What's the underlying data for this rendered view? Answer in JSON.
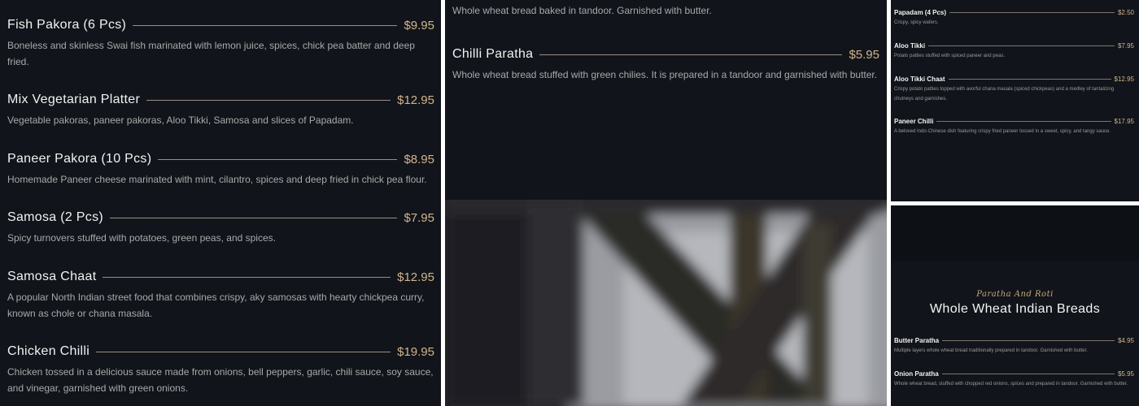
{
  "left": {
    "items": [
      {
        "name": "Fish Pakora (6 Pcs)",
        "price": "$9.95",
        "desc": "Boneless and skinless Swai fish marinated with lemon juice, spices, chick pea batter and deep fried."
      },
      {
        "name": "Mix Vegetarian Platter",
        "price": "$12.95",
        "desc": "Vegetable pakoras, paneer pakoras, Aloo Tikki, Samosa and slices of Papadam."
      },
      {
        "name": "Paneer Pakora (10 Pcs)",
        "price": "$8.95",
        "desc": "Homemade Paneer cheese marinated with mint, cilantro, spices and deep fried in chick pea flour."
      },
      {
        "name": "Samosa (2 Pcs)",
        "price": "$7.95",
        "desc": "Spicy turnovers stuffed with potatoes, green peas, and spices."
      },
      {
        "name": "Samosa Chaat",
        "price": "$12.95",
        "desc": "A popular North Indian street food that combines crispy, aky samosas with hearty chickpea curry, known as chole or chana masala."
      },
      {
        "name": "Chicken Chilli",
        "price": "$19.95",
        "desc": "Chicken tossed in a delicious sauce made from onions, bell peppers, garlic, chili sauce, soy sauce, and vinegar, garnished with green onions."
      }
    ]
  },
  "middle": {
    "top_text": "Whole wheat bread baked in tandoor. Garnished with butter.",
    "items": [
      {
        "name": "Chilli Paratha",
        "price": "$5.95",
        "desc": "Whole wheat bread stuffed with green chilies. It is prepared in a tandoor and garnished with butter."
      }
    ]
  },
  "right_top": {
    "items": [
      {
        "name": "Papadam (4 Pcs)",
        "price": "$2.50",
        "desc": "Crispy, spicy wafers."
      },
      {
        "name": "Aloo Tikki",
        "price": "$7.95",
        "desc": "Potato patties stuffed with spiced paneer and peas."
      },
      {
        "name": "Aloo Tikki Chaat",
        "price": "$12.95",
        "desc": "Crispy potato patties topped with avorful chana masala (spiced chickpeas) and a medley of tantalizing chutneys and garnishes."
      },
      {
        "name": "Paneer Chilli",
        "price": "$17.95",
        "desc": "A beloved Indo-Chinese dish featuring crispy fried paneer tossed in a sweet, spicy, and tangy sauce."
      }
    ]
  },
  "right_bottom": {
    "section_subtitle": "Paratha And Roti",
    "section_title": "Whole Wheat Indian Breads",
    "items": [
      {
        "name": "Butter Paratha",
        "price": "$4.95",
        "desc": "Multiple layers whole wheat bread traditionally prepared in tandoor. Garnished with butter."
      },
      {
        "name": "Onion Paratha",
        "price": "$5.95",
        "desc": "Whole wheat bread, stuffed with chopped red onions, spices and prepared in tandoor. Garnished with butter."
      }
    ]
  },
  "colors": {
    "background": "#11141a",
    "price": "#d2b48c",
    "title": "#f2f2f2",
    "desc": "#a9a9a9"
  }
}
